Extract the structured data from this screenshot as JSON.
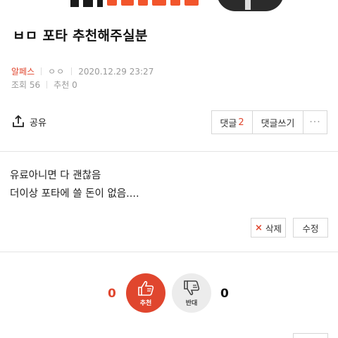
{
  "banner": {
    "brand_color": "#f2552c"
  },
  "post": {
    "title": "ㅂㅁ 포타 추천해주실분",
    "author": "알페스",
    "author_color": "#e0462e",
    "nickname": "ㅇㅇ",
    "date": "2020.12.29 23:27",
    "views_label": "조회 56",
    "likes_label": "추천 0",
    "content_lines": [
      "유료아니면 다 괜찮음",
      "더이상 포타에 쓸 돈이 없음...."
    ]
  },
  "toolbar": {
    "share_label": "공유",
    "share_icon": "share-icon",
    "comments_label": "댓글",
    "comments_count": "2",
    "write_comment_label": "댓글쓰기",
    "more_label": "···"
  },
  "actions": {
    "delete_label": "삭제",
    "delete_icon": "×",
    "edit_label": "수정"
  },
  "votes": {
    "up_count": "0",
    "up_label": "추천",
    "up_color": "#e0462e",
    "down_count": "0",
    "down_label": "반대"
  }
}
